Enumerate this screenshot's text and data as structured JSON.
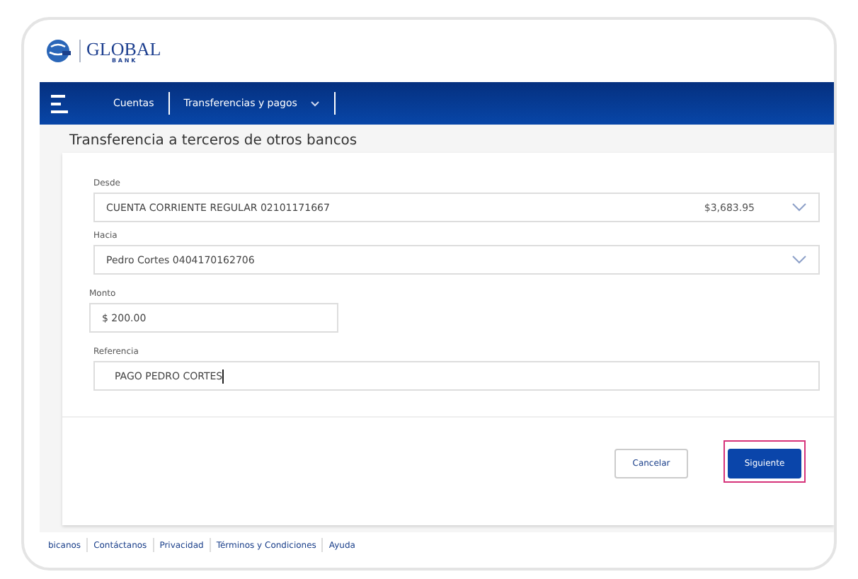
{
  "logo": {
    "name": "GLOBAL",
    "sub": "B A N K"
  },
  "nav": {
    "items": [
      {
        "label": "Cuentas",
        "dropdown": false
      },
      {
        "label": "Transferencias y pagos",
        "dropdown": true
      }
    ]
  },
  "page_title": "Transferencia a terceros de otros bancos",
  "form": {
    "fields": [
      {
        "kind": "select",
        "label": "Desde",
        "value": "CUENTA CORRIENTE REGULAR 02101171667",
        "amount": "$3,683.95"
      },
      {
        "kind": "select",
        "label": "Hacia",
        "value": "Pedro Cortes 0404170162706"
      },
      {
        "kind": "short",
        "label": "Monto",
        "value": "$ 200.00"
      },
      {
        "kind": "text",
        "label": "Referencia",
        "value": "PAGO  PEDRO CORTES"
      }
    ]
  },
  "buttons": [
    {
      "label": "Cancelar",
      "kind": "secondary",
      "highlighted": false
    },
    {
      "label": "Siguiente",
      "kind": "primary",
      "highlighted": true
    }
  ],
  "footer_links": [
    "bicanos",
    "Contáctanos",
    "Privacidad",
    "Términos y Condiciones",
    "Ayuda"
  ]
}
